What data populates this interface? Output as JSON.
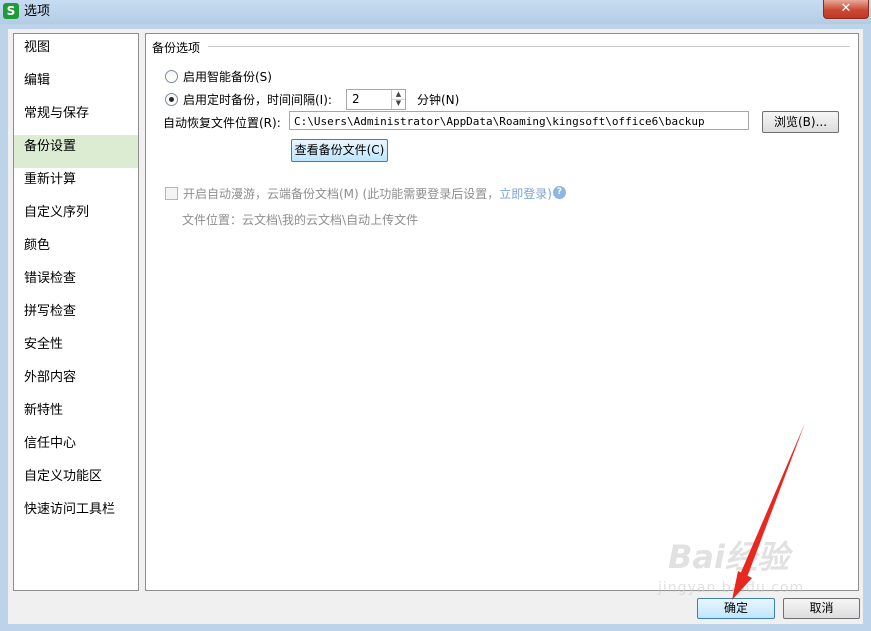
{
  "window": {
    "title": "选项",
    "app_icon": "S",
    "close_label": "✕"
  },
  "sidebar": {
    "items": [
      {
        "label": "视图"
      },
      {
        "label": "编辑"
      },
      {
        "label": "常规与保存"
      },
      {
        "label": "备份设置",
        "active": true
      },
      {
        "label": "重新计算"
      },
      {
        "label": "自定义序列"
      },
      {
        "label": "颜色"
      },
      {
        "label": "错误检查"
      },
      {
        "label": "拼写检查"
      },
      {
        "label": "安全性"
      },
      {
        "label": "外部内容"
      },
      {
        "label": "新特性"
      },
      {
        "label": "信任中心"
      },
      {
        "label": "自定义功能区"
      },
      {
        "label": "快速访问工具栏"
      }
    ]
  },
  "backup": {
    "section_title": "备份选项",
    "smart_backup_label": "启用智能备份(S)",
    "smart_backup_checked": false,
    "timed_backup_label": "启用定时备份，时间间隔(I):",
    "timed_backup_checked": true,
    "interval_value": "2",
    "interval_unit": "分钟(N)",
    "recovery_label": "自动恢复文件位置(R):",
    "recovery_path": "C:\\Users\\Administrator\\AppData\\Roaming\\kingsoft\\office6\\backup",
    "browse_label": "浏览(B)...",
    "view_backup_label": "查看备份文件(C)",
    "cloud_label": "开启自动漫游，云端备份文档(M) (此功能需要登录后设置，",
    "login_link": "立即登录)",
    "cloud_checked": false,
    "file_location": "文件位置：云文档\\我的云文档\\自动上传文件"
  },
  "footer": {
    "ok_label": "确定",
    "cancel_label": "取消"
  },
  "watermark": {
    "brand": "Bai经验",
    "url": "jingyan.baidu.com"
  },
  "colors": {
    "active_nav": "#dcecd3",
    "arrow": "#e8281e",
    "window_frame": "#bcd3ea"
  }
}
